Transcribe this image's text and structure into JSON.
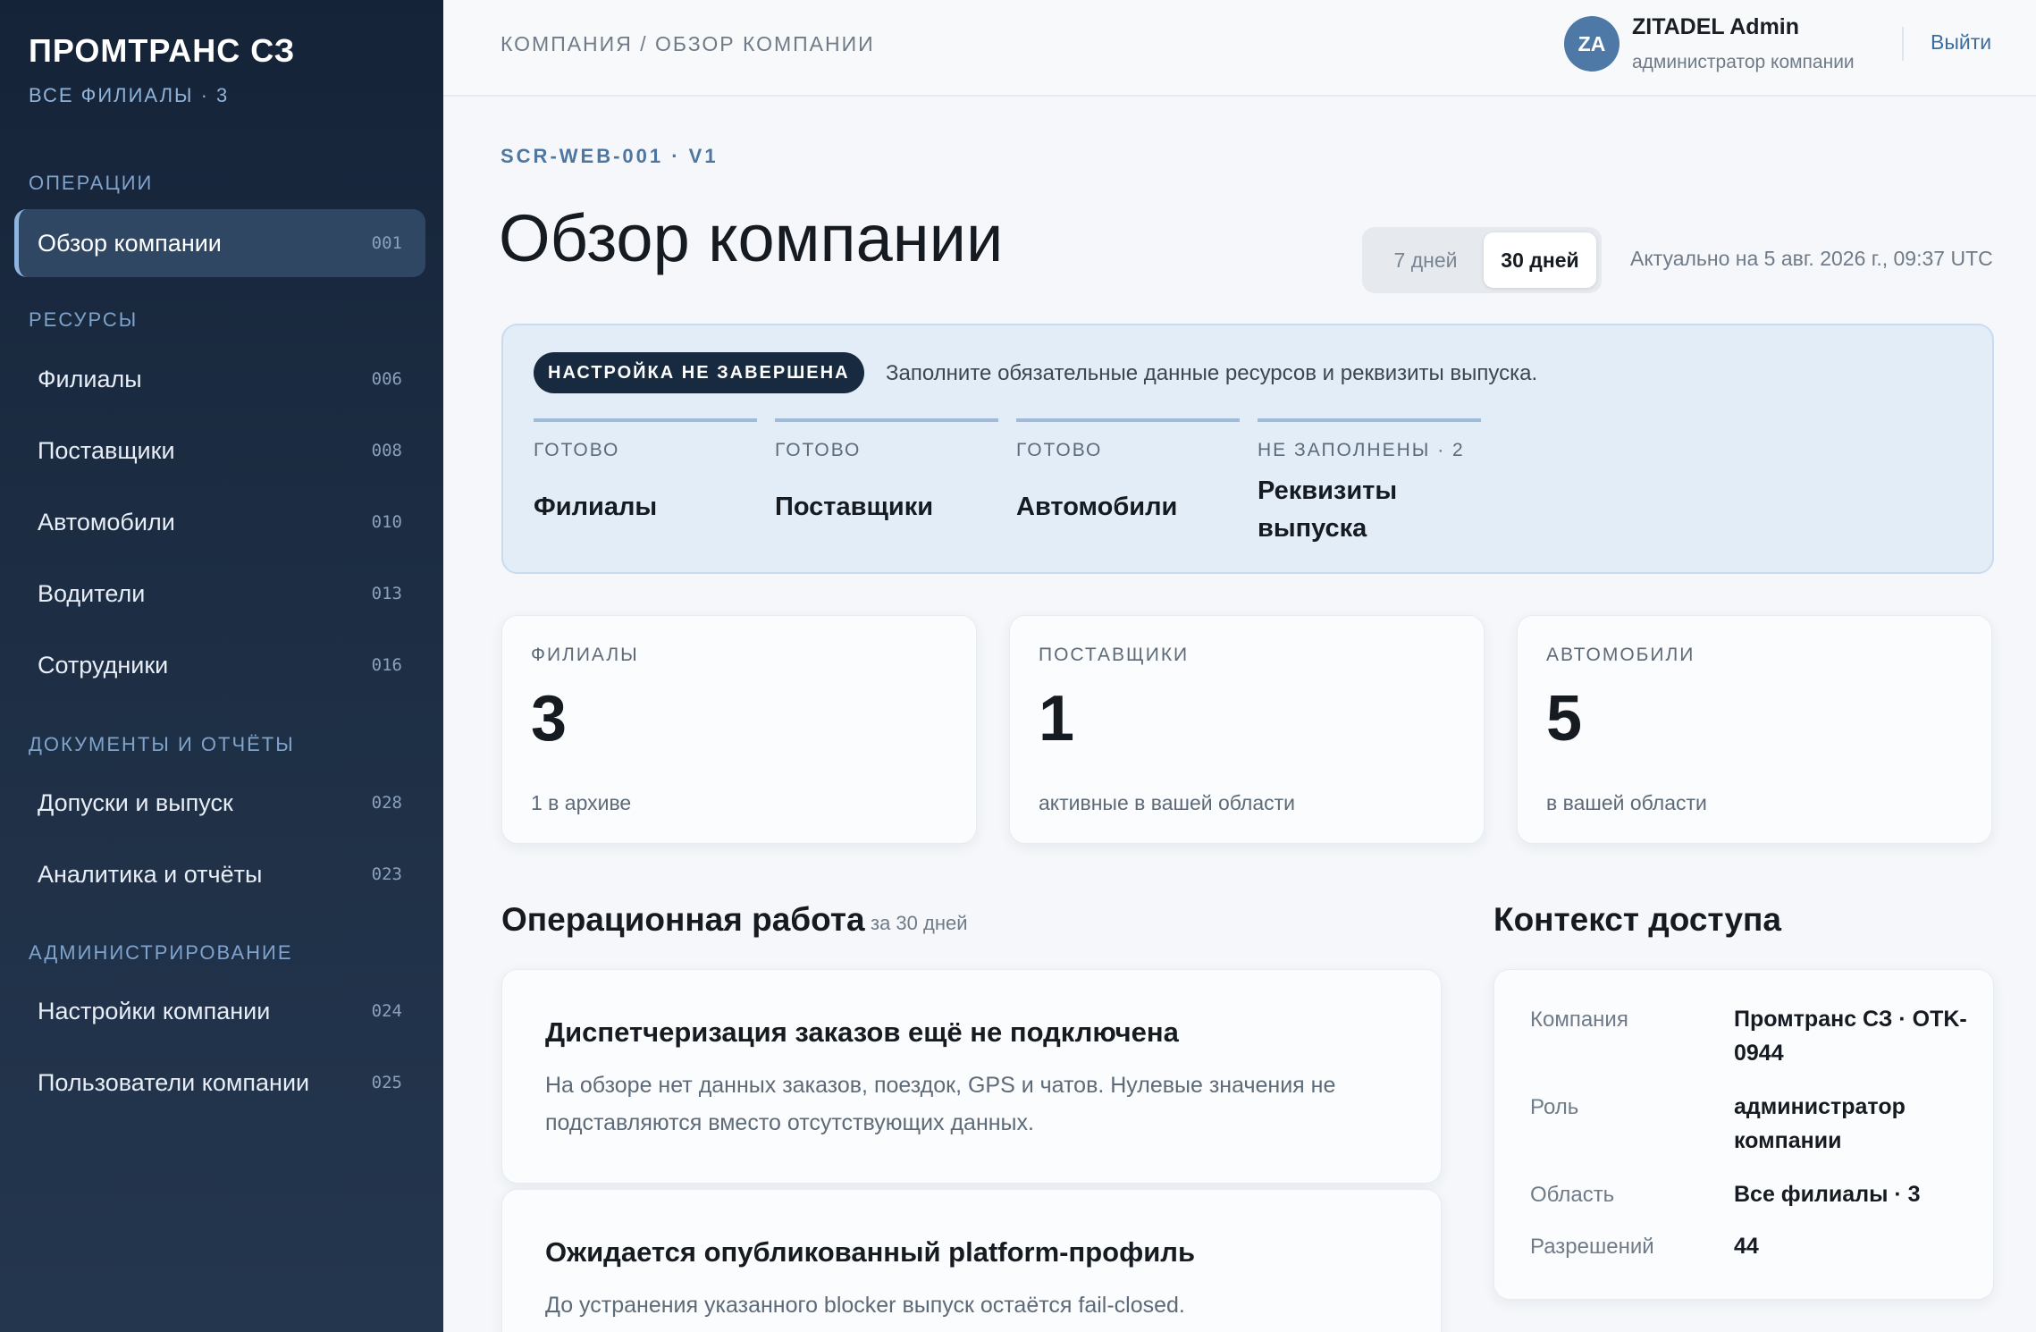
{
  "brand": {
    "title": "ПРОМТРАНС СЗ",
    "subtitle": "ВСЕ ФИЛИАЛЫ · 3"
  },
  "sidebar": {
    "sections": [
      {
        "title": "ОПЕРАЦИИ",
        "items": [
          {
            "label": "Обзор компании",
            "code": "001",
            "active": true
          }
        ]
      },
      {
        "title": "РЕСУРСЫ",
        "items": [
          {
            "label": "Филиалы",
            "code": "006"
          },
          {
            "label": "Поставщики",
            "code": "008"
          },
          {
            "label": "Автомобили",
            "code": "010"
          },
          {
            "label": "Водители",
            "code": "013"
          },
          {
            "label": "Сотрудники",
            "code": "016"
          }
        ]
      },
      {
        "title": "ДОКУМЕНТЫ И ОТЧЁТЫ",
        "items": [
          {
            "label": "Допуски и выпуск",
            "code": "028"
          },
          {
            "label": "Аналитика и отчёты",
            "code": "023"
          }
        ]
      },
      {
        "title": "АДМИНИСТРИРОВАНИЕ",
        "items": [
          {
            "label": "Настройки компании",
            "code": "024"
          },
          {
            "label": "Пользователи компании",
            "code": "025"
          }
        ]
      }
    ]
  },
  "topbar": {
    "breadcrumb": "КОМПАНИЯ / ОБЗОР КОМПАНИИ",
    "user": {
      "initials": "ZA",
      "name": "ZITADEL Admin",
      "role": "администратор компании"
    },
    "logout": "Выйти"
  },
  "page": {
    "screen_code": "SCR-WEB-001 · V1",
    "title": "Обзор компании",
    "range": {
      "options": [
        "7 дней",
        "30 дней"
      ],
      "selected": "30 дней"
    },
    "updated": "Актуально на 5 авг. 2026 г., 09:37 UTC"
  },
  "setup": {
    "badge": "НАСТРОЙКА НЕ ЗАВЕРШЕНА",
    "message": "Заполните обязательные данные ресурсов и реквизиты выпуска.",
    "items": [
      {
        "state": "ГОТОВО",
        "name": "Филиалы"
      },
      {
        "state": "ГОТОВО",
        "name": "Поставщики"
      },
      {
        "state": "ГОТОВО",
        "name": "Автомобили"
      },
      {
        "state": "НЕ ЗАПОЛНЕНЫ · 2",
        "name": "Реквизиты выпуска"
      }
    ]
  },
  "stats": [
    {
      "label": "ФИЛИАЛЫ",
      "value": "3",
      "note": "1 в архиве"
    },
    {
      "label": "ПОСТАВЩИКИ",
      "value": "1",
      "note": "активные в вашей области"
    },
    {
      "label": "АВТОМОБИЛИ",
      "value": "5",
      "note": "в вашей области"
    }
  ],
  "operations": {
    "title": "Операционная работа",
    "period": "за 30 дней",
    "cards": [
      {
        "title": "Диспетчеризация заказов ещё не подключена",
        "desc": "На обзоре нет данных заказов, поездок, GPS и чатов. Нулевые значения не подставляются вместо отсутствующих данных."
      },
      {
        "title": "Ожидается опубликованный platform-профиль",
        "desc": "До устранения указанного blocker выпуск остаётся fail-closed."
      }
    ]
  },
  "access": {
    "title": "Контекст доступа",
    "rows": [
      {
        "key": "Компания",
        "value": "Промтранс СЗ · OTK-0944"
      },
      {
        "key": "Роль",
        "value": "администратор компании"
      },
      {
        "key": "Область",
        "value": "Все филиалы · 3"
      },
      {
        "key": "Разрешений",
        "value": "44"
      }
    ]
  }
}
